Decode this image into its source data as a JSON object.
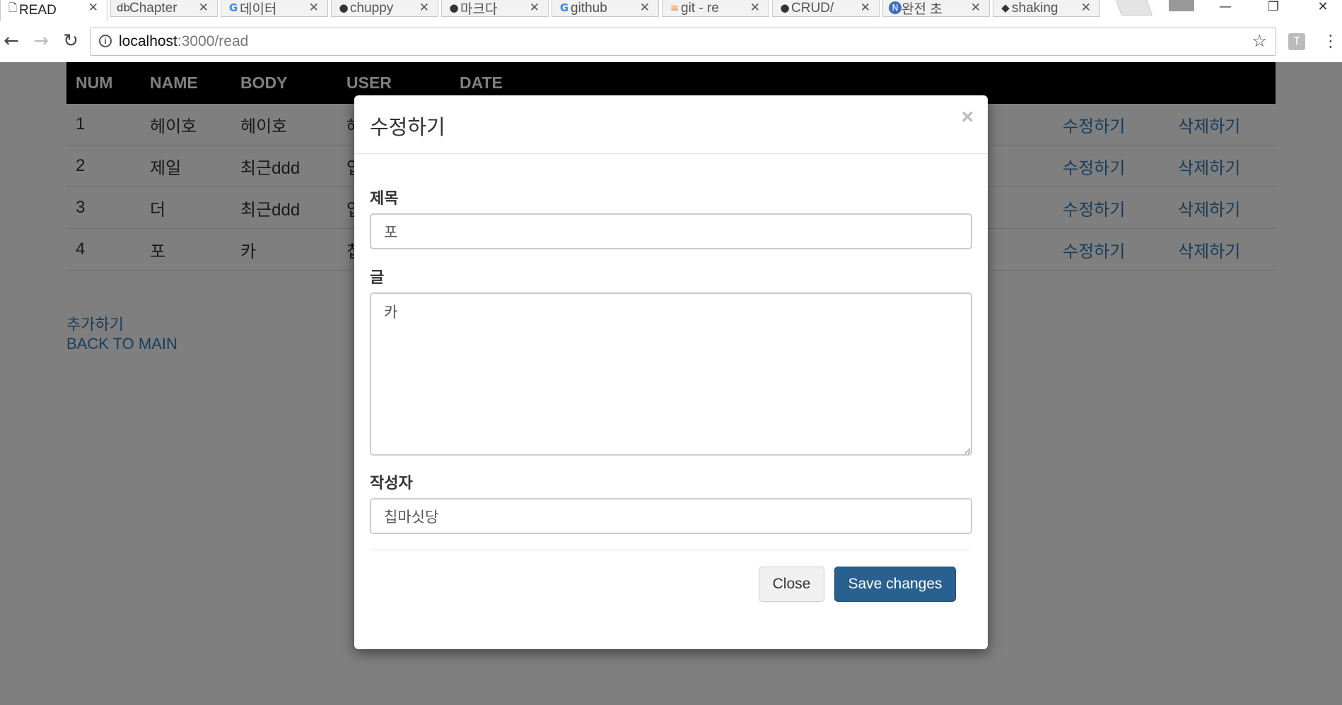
{
  "browser": {
    "tabs": [
      {
        "label": "READ",
        "icon": "page-icon",
        "active": true
      },
      {
        "label": "Chapter",
        "icon": "db-icon"
      },
      {
        "label": "데이터",
        "icon": "google-icon"
      },
      {
        "label": "chuppy",
        "icon": "github-icon"
      },
      {
        "label": "마크다",
        "icon": "github-icon"
      },
      {
        "label": "github",
        "icon": "google-icon"
      },
      {
        "label": "git - re",
        "icon": "stackoverflow-icon"
      },
      {
        "label": "CRUD/",
        "icon": "github-icon"
      },
      {
        "label": "완전 초",
        "icon": "n-icon"
      },
      {
        "label": "shaking",
        "icon": "shield-icon"
      }
    ],
    "url_host": "localhost",
    "url_path": ":3000/read",
    "extension_label": "T"
  },
  "table": {
    "headers": [
      "NUM",
      "NAME",
      "BODY",
      "USER",
      "DATE"
    ],
    "rows": [
      {
        "num": "1",
        "name": "헤이호",
        "body": "헤이호",
        "user": "헤",
        "edit": "수정하기",
        "delete": "삭제하기"
      },
      {
        "num": "2",
        "name": "제일",
        "body": "최근ddd",
        "user": "업",
        "edit": "수정하기",
        "delete": "삭제하기"
      },
      {
        "num": "3",
        "name": "더",
        "body": "최근ddd",
        "user": "업",
        "edit": "수정하기",
        "delete": "삭제하기"
      },
      {
        "num": "4",
        "name": "포",
        "body": "카",
        "user": "칩",
        "edit": "수정하기",
        "delete": "삭제하기"
      }
    ]
  },
  "links": {
    "add": "추가하기",
    "back": "BACK TO MAIN"
  },
  "modal": {
    "title": "수정하기",
    "close_x": "×",
    "title_label": "제목",
    "title_value": "포",
    "body_label": "글",
    "body_value": "카",
    "author_label": "작성자",
    "author_value": "칩마싯당",
    "close_button": "Close",
    "save_button": "Save changes"
  }
}
